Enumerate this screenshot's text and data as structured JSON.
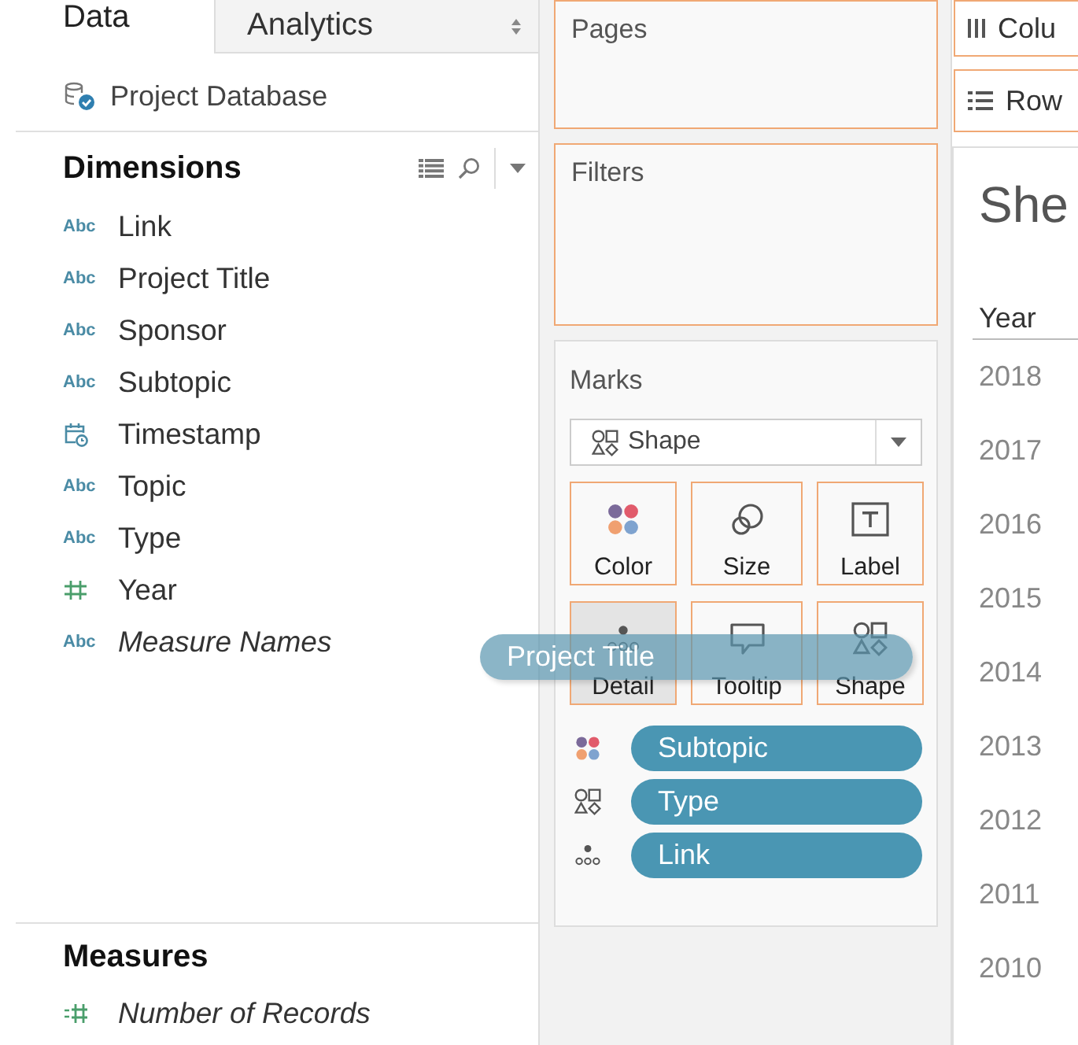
{
  "tabs": [
    {
      "label": "Data",
      "selected": true
    },
    {
      "label": "Analytics",
      "selected": false
    }
  ],
  "data_source": {
    "name": "Project Database"
  },
  "dimensions": {
    "title": "Dimensions",
    "items": [
      {
        "name": "Link",
        "kind": "string",
        "badge": "Abc",
        "generated": false
      },
      {
        "name": "Project Title",
        "kind": "string",
        "badge": "Abc",
        "generated": false
      },
      {
        "name": "Sponsor",
        "kind": "string",
        "badge": "Abc",
        "generated": false
      },
      {
        "name": "Subtopic",
        "kind": "string",
        "badge": "Abc",
        "generated": false
      },
      {
        "name": "Timestamp",
        "kind": "date",
        "generated": false
      },
      {
        "name": "Topic",
        "kind": "string",
        "badge": "Abc",
        "generated": false
      },
      {
        "name": "Type",
        "kind": "string",
        "badge": "Abc",
        "generated": false
      },
      {
        "name": "Year",
        "kind": "number",
        "generated": false
      },
      {
        "name": "Measure Names",
        "kind": "string",
        "badge": "Abc",
        "generated": true
      }
    ]
  },
  "measures": {
    "title": "Measures",
    "items": [
      {
        "name": "Number of Records",
        "kind": "measure",
        "generated": true
      }
    ]
  },
  "pages": {
    "title": "Pages"
  },
  "filters": {
    "title": "Filters"
  },
  "marks": {
    "title": "Marks",
    "mark_type": "Shape",
    "cards": [
      {
        "label": "Color",
        "kind": "color",
        "selected": false
      },
      {
        "label": "Size",
        "kind": "size",
        "selected": false
      },
      {
        "label": "Label",
        "kind": "label",
        "selected": false
      },
      {
        "label": "Detail",
        "kind": "detail",
        "selected": true
      },
      {
        "label": "Tooltip",
        "kind": "tooltip",
        "selected": false
      },
      {
        "label": "Shape",
        "kind": "shape",
        "selected": false
      }
    ],
    "fields": [
      {
        "name": "Subtopic",
        "kind": "color"
      },
      {
        "name": "Type",
        "kind": "shape"
      },
      {
        "name": "Link",
        "kind": "detail"
      }
    ]
  },
  "columns_shelf": {
    "label": "Colu"
  },
  "rows_shelf": {
    "label": "Row"
  },
  "sheet": {
    "title": "She",
    "column_header": "Year",
    "rows": [
      "2018",
      "2017",
      "2016",
      "2015",
      "2014",
      "2013",
      "2012",
      "2011",
      "2010"
    ]
  },
  "dragged_pill": {
    "label": "Project Title"
  }
}
